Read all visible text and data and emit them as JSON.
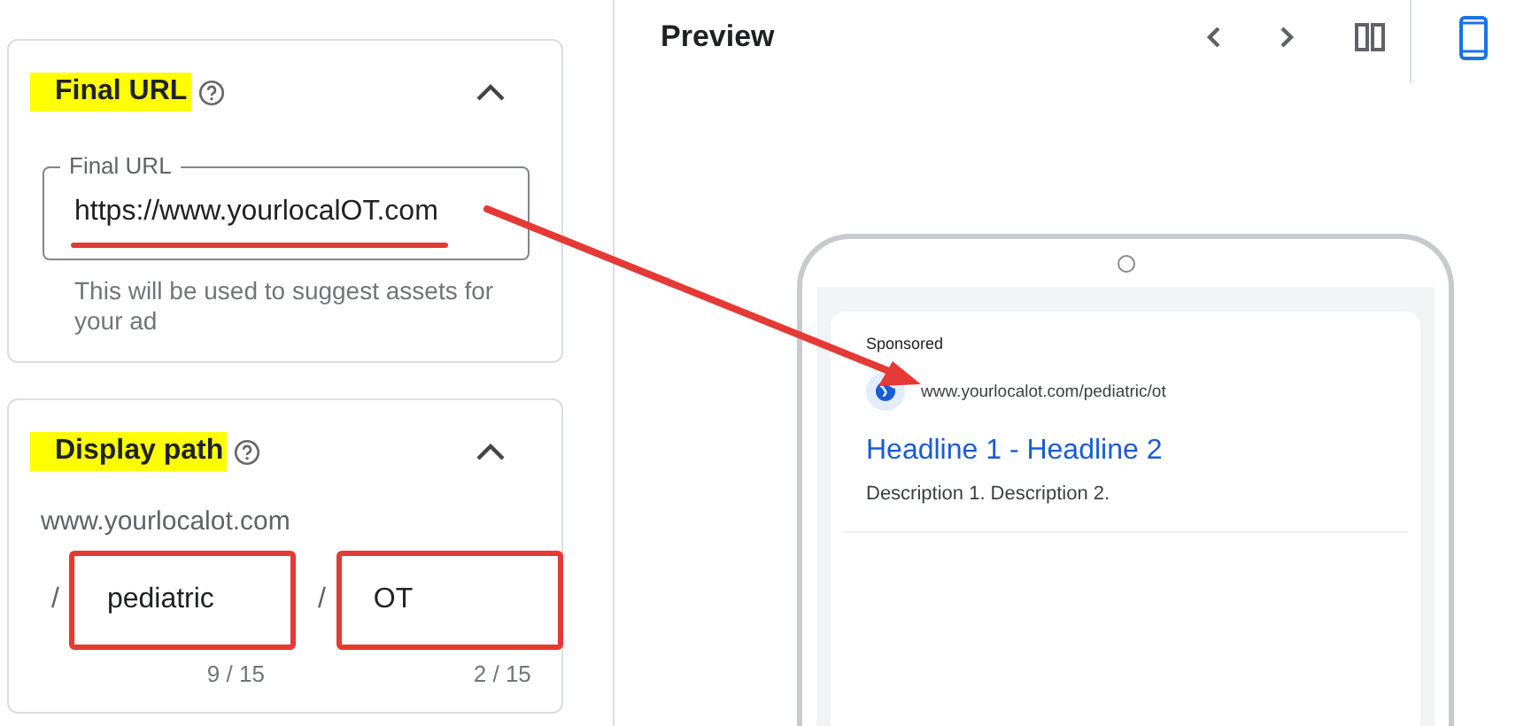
{
  "form": {
    "sections": [
      {
        "kind": "url",
        "title": "Final URL",
        "highlighted": true,
        "expanded": true,
        "field": {
          "label": "Final URL",
          "value": "https://www.yourlocalOT.com",
          "underlined": true
        },
        "helper": "This will be used to suggest assets for your ad"
      },
      {
        "kind": "path",
        "title": "Display path",
        "highlighted": true,
        "expanded": true,
        "domain": "www.yourlocalot.com",
        "paths": [
          {
            "separator": "/",
            "value": "pediatric",
            "counter": "9 / 15",
            "outlined": true
          },
          {
            "separator": "/",
            "value": "OT",
            "counter": "2 / 15",
            "outlined": true
          }
        ]
      }
    ]
  },
  "preview": {
    "title": "Preview",
    "ad": {
      "label": "Sponsored",
      "url": "www.yourlocalot.com/pediatric/ot",
      "headline": "Headline 1 - Headline 2",
      "description": "Description 1. Description 2."
    }
  },
  "annotation": {
    "arrow": true
  }
}
